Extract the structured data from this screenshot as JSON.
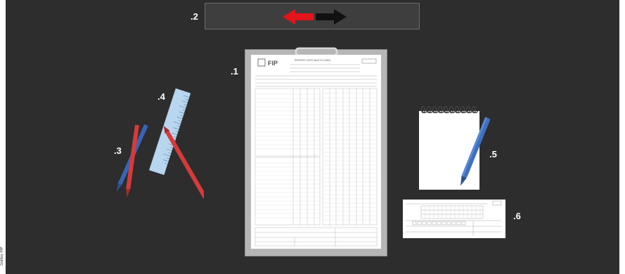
{
  "side_caption": "Gráfico: FIP",
  "labels": {
    "toolbar": ".2",
    "scoresheet": ".1",
    "ruler": ".4",
    "pencils": ".3",
    "notepad": ".5",
    "card": ".6"
  },
  "toolbar": {
    "left_arrow_color": "#e3141b",
    "right_arrow_color": "#111111",
    "left_arrow_icon": "arrow-left-icon",
    "right_arrow_icon": "arrow-right-icon"
  },
  "scoresheet": {
    "brand": "FIP",
    "title": "REFERTO UFFICIALE DI GARA"
  },
  "colors": {
    "background": "#2d2d2d",
    "pencil_red": "#d83a3a",
    "pencil_blue": "#3565b6",
    "ruler": "#b9d6ef"
  }
}
